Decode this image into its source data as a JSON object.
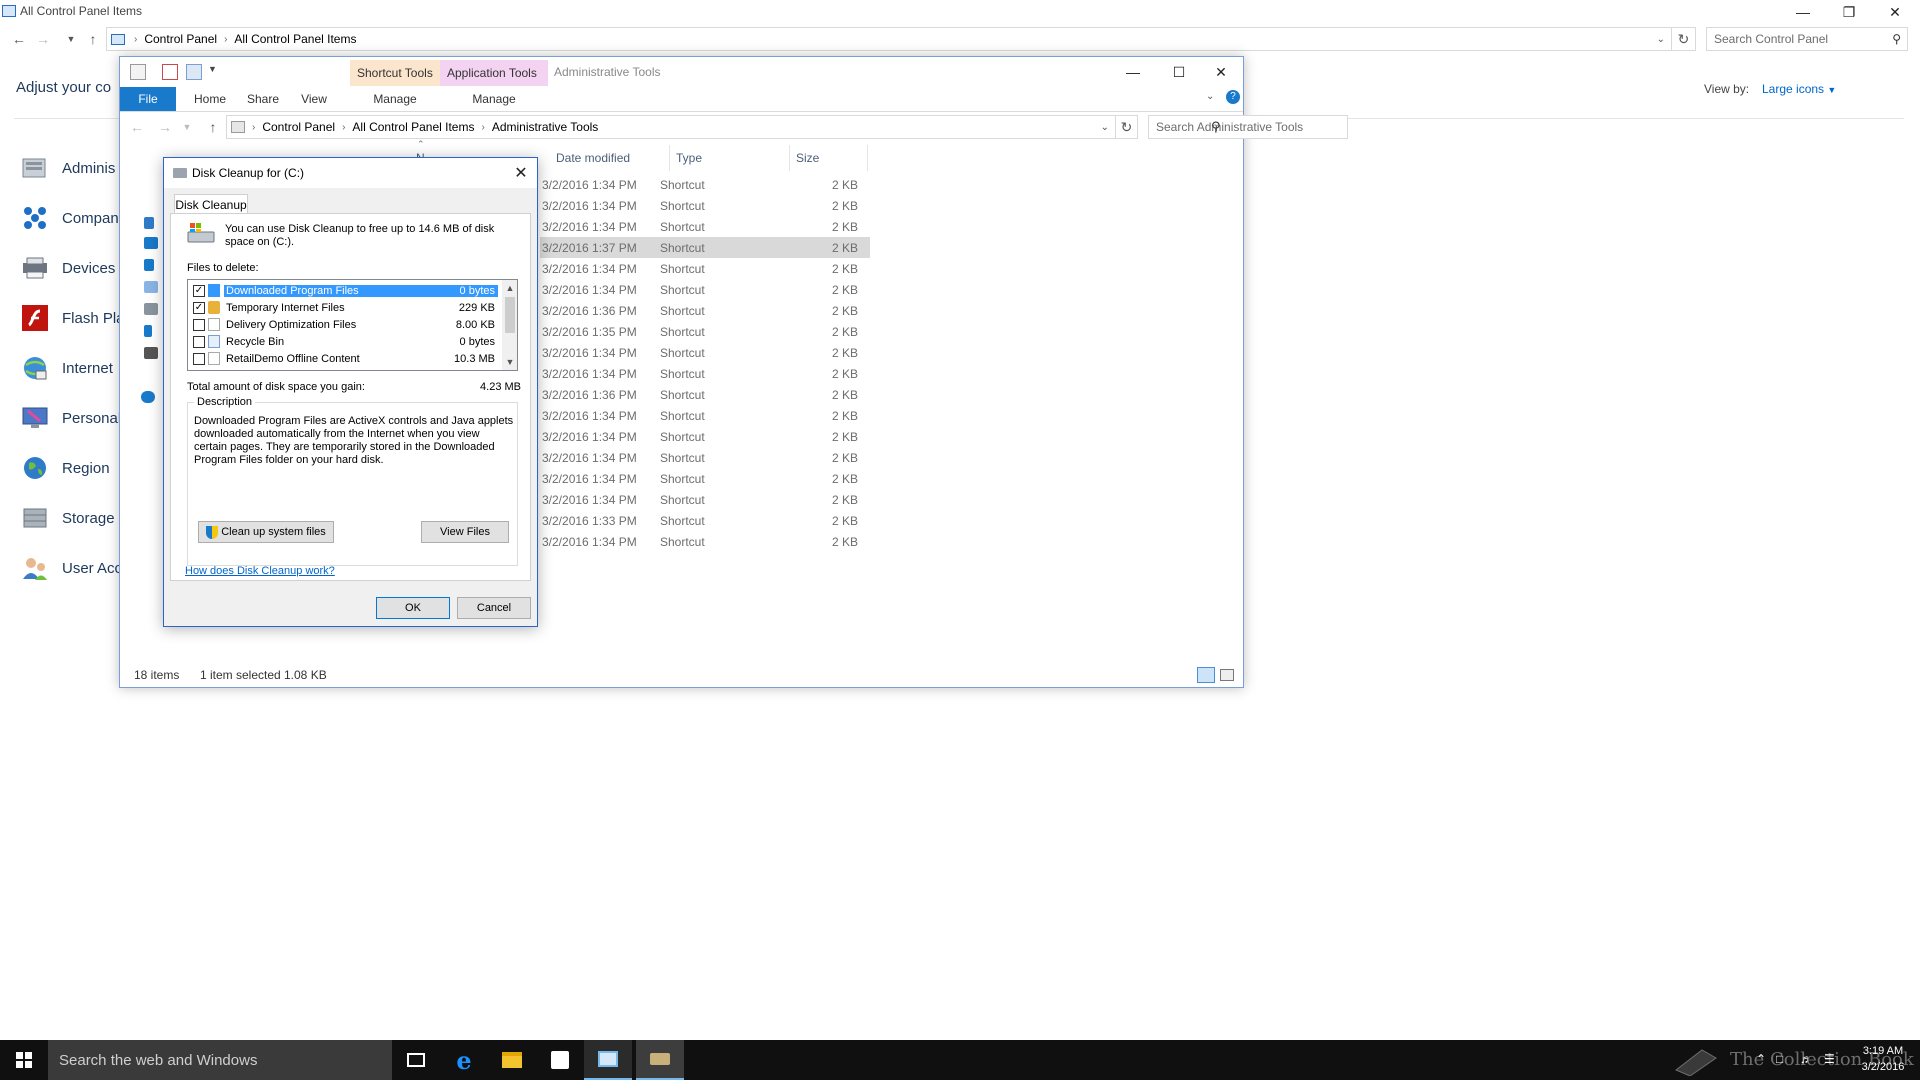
{
  "cp_window": {
    "title": "All Control Panel Items",
    "breadcrumbs": [
      "Control Panel",
      "All Control Panel Items"
    ],
    "search_placeholder": "Search Control Panel",
    "heading": "Adjust your co",
    "view_by_label": "View by:",
    "view_by_value": "Large icons",
    "items": [
      {
        "label": "Adminis",
        "icon": "administrative-tools-icon"
      },
      {
        "label": "Compan",
        "icon": "company-icon"
      },
      {
        "label": "Devices",
        "icon": "devices-icon"
      },
      {
        "label": "Flash Pla",
        "icon": "flash-player-icon"
      },
      {
        "label": "Internet",
        "icon": "internet-options-icon"
      },
      {
        "label": "Personal",
        "icon": "personalization-icon"
      },
      {
        "label": "Region",
        "icon": "region-icon"
      },
      {
        "label": "Storage",
        "icon": "storage-icon"
      },
      {
        "label": "User Acc",
        "icon": "user-accounts-icon"
      }
    ]
  },
  "explorer": {
    "title": "Administrative Tools",
    "ctx_shortcut": "Shortcut Tools",
    "ctx_app": "Application Tools",
    "tabs": {
      "file": "File",
      "home": "Home",
      "share": "Share",
      "view": "View",
      "manage1": "Manage",
      "manage2": "Manage"
    },
    "breadcrumbs": [
      "Control Panel",
      "All Control Panel Items",
      "Administrative Tools"
    ],
    "search_placeholder": "Search Administrative Tools",
    "columns": {
      "name": "N",
      "date": "Date modified",
      "type": "Type",
      "size": "Size"
    },
    "rows": [
      {
        "date": "3/2/2016 1:34 PM",
        "type": "Shortcut",
        "size": "2 KB"
      },
      {
        "date": "3/2/2016 1:34 PM",
        "type": "Shortcut",
        "size": "2 KB"
      },
      {
        "date": "3/2/2016 1:34 PM",
        "type": "Shortcut",
        "size": "2 KB"
      },
      {
        "date": "3/2/2016 1:37 PM",
        "type": "Shortcut",
        "size": "2 KB"
      },
      {
        "date": "3/2/2016 1:34 PM",
        "type": "Shortcut",
        "size": "2 KB"
      },
      {
        "date": "3/2/2016 1:34 PM",
        "type": "Shortcut",
        "size": "2 KB"
      },
      {
        "date": "3/2/2016 1:36 PM",
        "type": "Shortcut",
        "size": "2 KB"
      },
      {
        "date": "3/2/2016 1:35 PM",
        "type": "Shortcut",
        "size": "2 KB"
      },
      {
        "date": "3/2/2016 1:34 PM",
        "type": "Shortcut",
        "size": "2 KB"
      },
      {
        "date": "3/2/2016 1:34 PM",
        "type": "Shortcut",
        "size": "2 KB"
      },
      {
        "date": "3/2/2016 1:36 PM",
        "type": "Shortcut",
        "size": "2 KB"
      },
      {
        "date": "3/2/2016 1:34 PM",
        "type": "Shortcut",
        "size": "2 KB"
      },
      {
        "date": "3/2/2016 1:34 PM",
        "type": "Shortcut",
        "size": "2 KB"
      },
      {
        "date": "3/2/2016 1:34 PM",
        "type": "Shortcut",
        "size": "2 KB"
      },
      {
        "date": "3/2/2016 1:34 PM",
        "type": "Shortcut",
        "size": "2 KB"
      },
      {
        "date": "3/2/2016 1:34 PM",
        "type": "Shortcut",
        "size": "2 KB"
      },
      {
        "date": "3/2/2016 1:33 PM",
        "type": "Shortcut",
        "size": "2 KB"
      },
      {
        "date": "3/2/2016 1:34 PM",
        "type": "Shortcut",
        "size": "2 KB"
      }
    ],
    "selected_row": 3,
    "status_items": "18 items",
    "status_selected": "1 item selected",
    "status_size": "1.08 KB"
  },
  "dialog": {
    "title": "Disk Cleanup for  (C:)",
    "tab": "Disk Cleanup",
    "intro": "You can use Disk Cleanup to free up to 14.6 MB of disk space on  (C:).",
    "files_to_delete": "Files to delete:",
    "files": [
      {
        "name": "Downloaded Program Files",
        "size": "0 bytes",
        "checked": true,
        "selected": true
      },
      {
        "name": "Temporary Internet Files",
        "size": "229 KB",
        "checked": true,
        "selected": false
      },
      {
        "name": "Delivery Optimization Files",
        "size": "8.00 KB",
        "checked": false,
        "selected": false
      },
      {
        "name": "Recycle Bin",
        "size": "0 bytes",
        "checked": false,
        "selected": false
      },
      {
        "name": "RetailDemo Offline Content",
        "size": "10.3 MB",
        "checked": false,
        "selected": false
      }
    ],
    "total_label": "Total amount of disk space you gain:",
    "total_value": "4.23 MB",
    "description_legend": "Description",
    "description_text": "Downloaded Program Files are ActiveX controls and Java applets downloaded automatically from the Internet when you view certain pages. They are temporarily stored in the Downloaded Program Files folder on your hard disk.",
    "cleanup_button": "Clean up system files",
    "viewfiles_button": "View Files",
    "how_link": "How does Disk Cleanup work?",
    "ok": "OK",
    "cancel": "Cancel"
  },
  "taskbar": {
    "search_placeholder": "Search the web and Windows",
    "watermark": "The Collection Book",
    "time": "3:19 AM",
    "date": "3/2/2016"
  }
}
